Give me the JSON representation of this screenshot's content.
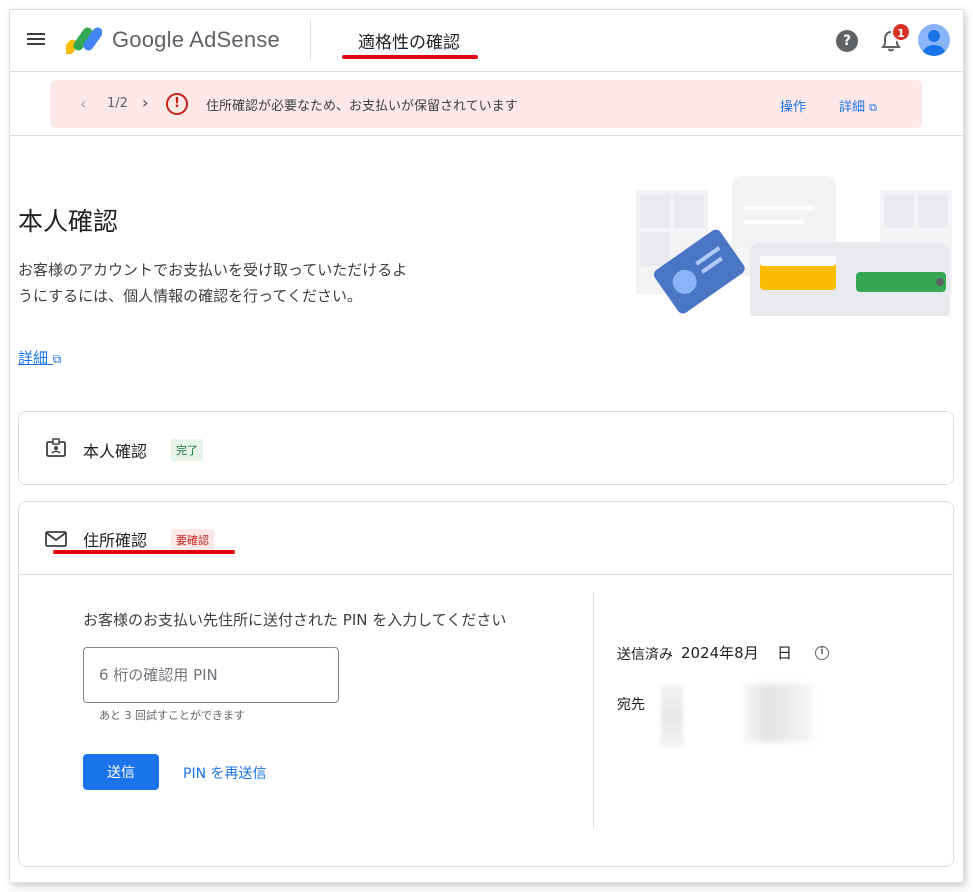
{
  "header": {
    "logo_text": "Google AdSense",
    "page_title": "適格性の確認",
    "notification_count": "1"
  },
  "banner": {
    "counter": "1/2",
    "message": "住所確認が必要なため、お支払いが保留されています",
    "action_label": "操作",
    "details_label": "詳細"
  },
  "hero": {
    "title": "本人確認",
    "description": "お客様のアカウントでお支払いを受け取っていただけるようにするには、個人情報の確認を行ってください。",
    "details_link": "詳細"
  },
  "identity_card": {
    "title": "本人確認",
    "status": "完了"
  },
  "address_card": {
    "title": "住所確認",
    "status": "要確認",
    "prompt": "お客様のお支払い先住所に送付された PIN を入力してください",
    "pin_placeholder": "6 桁の確認用 PIN",
    "pin_value": "",
    "attempts_hint": "あと 3 回試すことができます",
    "submit_label": "送信",
    "resend_label": "PIN を再送信",
    "sent_label": "送信済み",
    "sent_date": "2024年8月",
    "sent_day": "日",
    "recipient_label": "宛先"
  },
  "colors": {
    "accent": "#1a73e8",
    "danger": "#c5221f",
    "success": "#137333",
    "banner_bg": "#fce8e6",
    "annotation_red": "#e3000f"
  },
  "icons": {
    "menu": "menu-icon",
    "help": "help-icon",
    "bell": "notifications-icon",
    "alert": "error-icon",
    "external": "open-in-new-icon",
    "id_badge": "badge-icon",
    "mail": "mail-icon",
    "info": "info-icon"
  }
}
